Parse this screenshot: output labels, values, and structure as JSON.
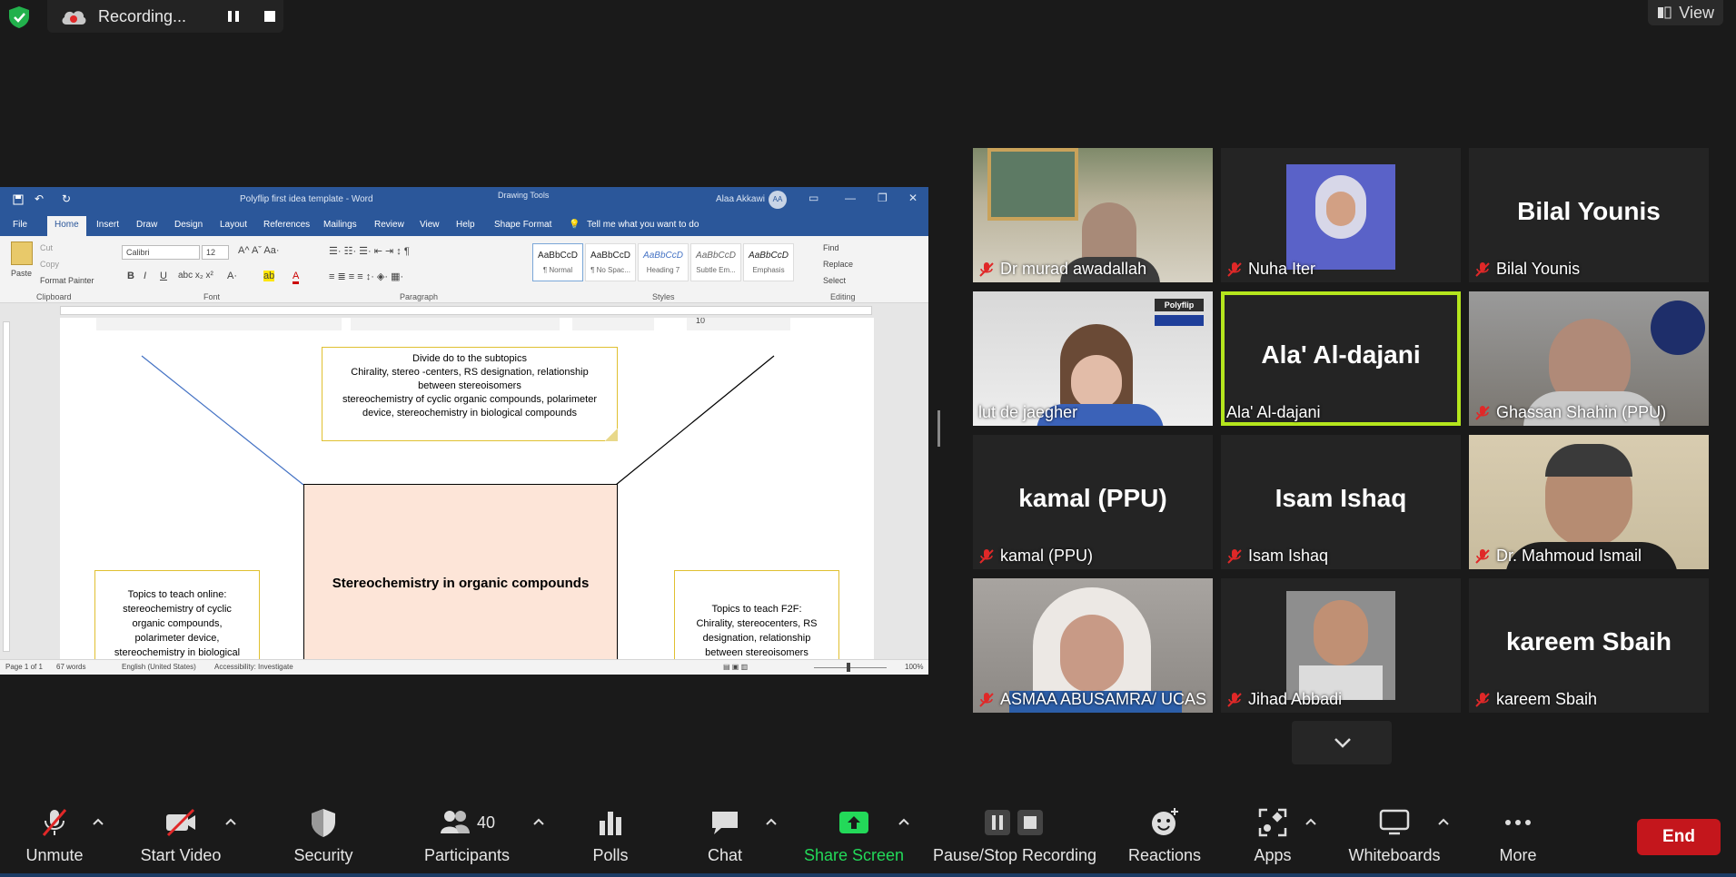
{
  "top_bar": {
    "recording_label": "Recording...",
    "view_label": "View"
  },
  "word": {
    "title": "Polyflip first idea template  -  Word",
    "drawing_tools": "Drawing Tools",
    "user_name": "Alaa Akkawi",
    "user_initials": "AA",
    "tabs": [
      "File",
      "Home",
      "Insert",
      "Draw",
      "Design",
      "Layout",
      "References",
      "Mailings",
      "Review",
      "View",
      "Help",
      "Shape Format"
    ],
    "tell_me": "Tell me what you want to do",
    "clipboard": {
      "paste": "Paste",
      "cut": "Cut",
      "copy": "Copy",
      "format_painter": "Format Painter",
      "group": "Clipboard"
    },
    "font": {
      "name": "Calibri",
      "size": "12",
      "group": "Font"
    },
    "paragraph_group": "Paragraph",
    "styles": [
      {
        "sample": "AaBbCcD",
        "name": "¶ Normal"
      },
      {
        "sample": "AaBbCcD",
        "name": "¶ No Spac..."
      },
      {
        "sample": "AaBbCcD",
        "name": "Heading 7"
      },
      {
        "sample": "AaBbCcD",
        "name": "Subtle Em..."
      },
      {
        "sample": "AaBbCcD",
        "name": "Emphasis"
      }
    ],
    "styles_group": "Styles",
    "editing": {
      "find": "Find",
      "replace": "Replace",
      "select": "Select",
      "group": "Editing"
    },
    "document": {
      "page_number_fragment": "10",
      "top_box": [
        "Divide do to the subtopics",
        "Chirality, stereo -centers, RS designation, relationship",
        "between stereoisomers",
        "stereochemistry of cyclic organic compounds, polarimeter",
        "device, stereochemistry in biological compounds"
      ],
      "center_box": "Stereochemistry in organic compounds",
      "left_box": [
        "Topics to teach online:",
        "stereochemistry of cyclic",
        "organic compounds,",
        "polarimeter device,",
        "stereochemistry in biological"
      ],
      "right_box": [
        "Topics to teach F2F:",
        "Chirality, stereocenters, RS",
        "designation, relationship",
        "between stereoisomers"
      ]
    },
    "status": {
      "page": "Page 1 of 1",
      "words": "67 words",
      "language": "English (United States)",
      "accessibility": "Accessibility: Investigate",
      "zoom": "100%"
    }
  },
  "gallery": {
    "tiles": [
      {
        "name": "Dr murad awadallah",
        "muted": true,
        "display": "",
        "active": false
      },
      {
        "name": "Nuha Iter",
        "muted": true,
        "display": "",
        "active": false
      },
      {
        "name": "Bilal Younis",
        "muted": true,
        "display": "Bilal Younis",
        "active": false
      },
      {
        "name": "lut de jaegher",
        "muted": false,
        "display": "",
        "active": false,
        "logo": "Polyflip"
      },
      {
        "name": "Ala' Al-dajani",
        "muted": false,
        "display": "Ala' Al-dajani",
        "active": true
      },
      {
        "name": "Ghassan Shahin (PPU)",
        "muted": true,
        "display": "",
        "active": false
      },
      {
        "name": "kamal (PPU)",
        "muted": true,
        "display": "kamal (PPU)",
        "active": false
      },
      {
        "name": "Isam Ishaq",
        "muted": true,
        "display": "Isam Ishaq",
        "active": false
      },
      {
        "name": "Dr. Mahmoud Ismail",
        "muted": true,
        "display": "",
        "active": false
      },
      {
        "name": "ASMAA ABUSAMRA/ UCAS",
        "muted": true,
        "display": "",
        "active": false
      },
      {
        "name": "Jihad Abbadi",
        "muted": true,
        "display": "",
        "active": false
      },
      {
        "name": "kareem Sbaih",
        "muted": true,
        "display": "kareem Sbaih",
        "active": false
      }
    ]
  },
  "toolbar": {
    "unmute": "Unmute",
    "start_video": "Start Video",
    "security": "Security",
    "participants": "Participants",
    "participants_count": "40",
    "polls": "Polls",
    "chat": "Chat",
    "share_screen": "Share Screen",
    "pause_stop_recording": "Pause/Stop Recording",
    "reactions": "Reactions",
    "apps": "Apps",
    "whiteboards": "Whiteboards",
    "more": "More",
    "end": "End"
  },
  "colors": {
    "share_green": "#23d959",
    "end_red": "#c4161c",
    "active_speaker": "#b5e61d",
    "muted_red": "#e02828",
    "word_blue": "#2b579a"
  }
}
